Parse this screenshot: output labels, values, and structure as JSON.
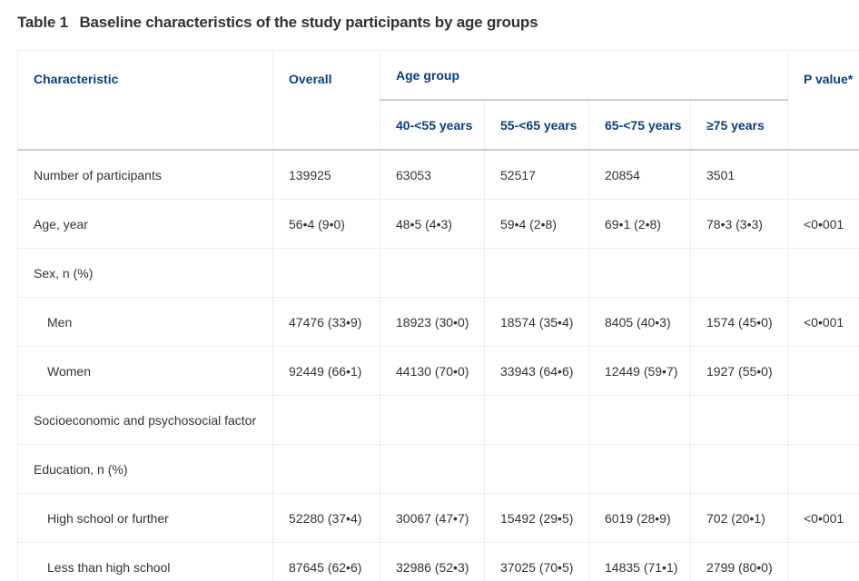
{
  "caption": {
    "number": "Table 1",
    "title": "Baseline characteristics of the study participants by age groups"
  },
  "header": {
    "characteristic": "Characteristic",
    "overall": "Overall",
    "age_group": "Age group",
    "p_value": "P value*",
    "age_bands": [
      "40-<55 years",
      "55-<65 years",
      "65-<75 years",
      "≥75 years"
    ]
  },
  "rows": [
    {
      "label": "Number of participants",
      "indent": false,
      "overall": "139925",
      "groups": [
        "63053",
        "52517",
        "20854",
        "3501"
      ],
      "p": ""
    },
    {
      "label": "Age, year",
      "indent": false,
      "overall": "56•4 (9•0)",
      "groups": [
        "48•5 (4•3)",
        "59•4 (2•8)",
        "69•1 (2•8)",
        "78•3 (3•3)"
      ],
      "p": "<0•001"
    },
    {
      "label": "Sex, n (%)",
      "indent": false,
      "overall": "",
      "groups": [
        "",
        "",
        "",
        ""
      ],
      "p": ""
    },
    {
      "label": "Men",
      "indent": true,
      "overall": "47476 (33•9)",
      "groups": [
        "18923 (30•0)",
        "18574 (35•4)",
        "8405 (40•3)",
        "1574 (45•0)"
      ],
      "p": "<0•001"
    },
    {
      "label": "Women",
      "indent": true,
      "overall": "92449 (66•1)",
      "groups": [
        "44130 (70•0)",
        "33943 (64•6)",
        "12449 (59•7)",
        "1927 (55•0)"
      ],
      "p": ""
    },
    {
      "label": "Socioeconomic and psychosocial factor",
      "indent": false,
      "overall": "",
      "groups": [
        "",
        "",
        "",
        ""
      ],
      "p": ""
    },
    {
      "label": "Education, n (%)",
      "indent": false,
      "overall": "",
      "groups": [
        "",
        "",
        "",
        ""
      ],
      "p": ""
    },
    {
      "label": "High school or further",
      "indent": true,
      "overall": "52280 (37•4)",
      "groups": [
        "30067 (47•7)",
        "15492 (29•5)",
        "6019 (28•9)",
        "702 (20•1)"
      ],
      "p": "<0•001"
    },
    {
      "label": "Less than high school",
      "indent": true,
      "overall": "87645 (62•6)",
      "groups": [
        "32986 (52•3)",
        "37025 (70•5)",
        "14835 (71•1)",
        "2799 (80•0)"
      ],
      "p": ""
    }
  ]
}
